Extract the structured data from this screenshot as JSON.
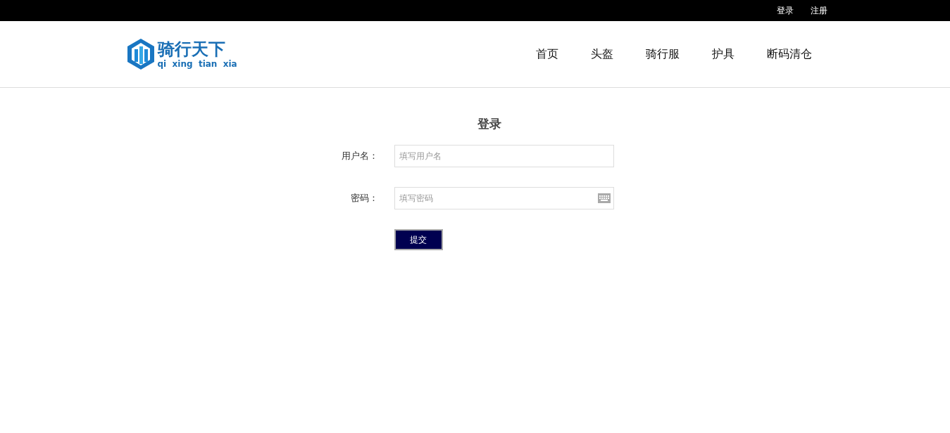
{
  "top_bar": {
    "links": [
      "登录",
      "注册"
    ]
  },
  "header": {
    "logo": {
      "title": "骑行天下",
      "subtitle": "qi  xing  tian  xia"
    },
    "nav": [
      "首页",
      "头盔",
      "骑行服",
      "护具",
      "断码清仓"
    ]
  },
  "login_form": {
    "title": "登录",
    "fields": [
      {
        "label": "用户名：",
        "placeholder": "填写用户名",
        "kind": "text"
      },
      {
        "label": "密码：",
        "placeholder": "填写密码",
        "kind": "password"
      }
    ],
    "submit": "提交"
  }
}
